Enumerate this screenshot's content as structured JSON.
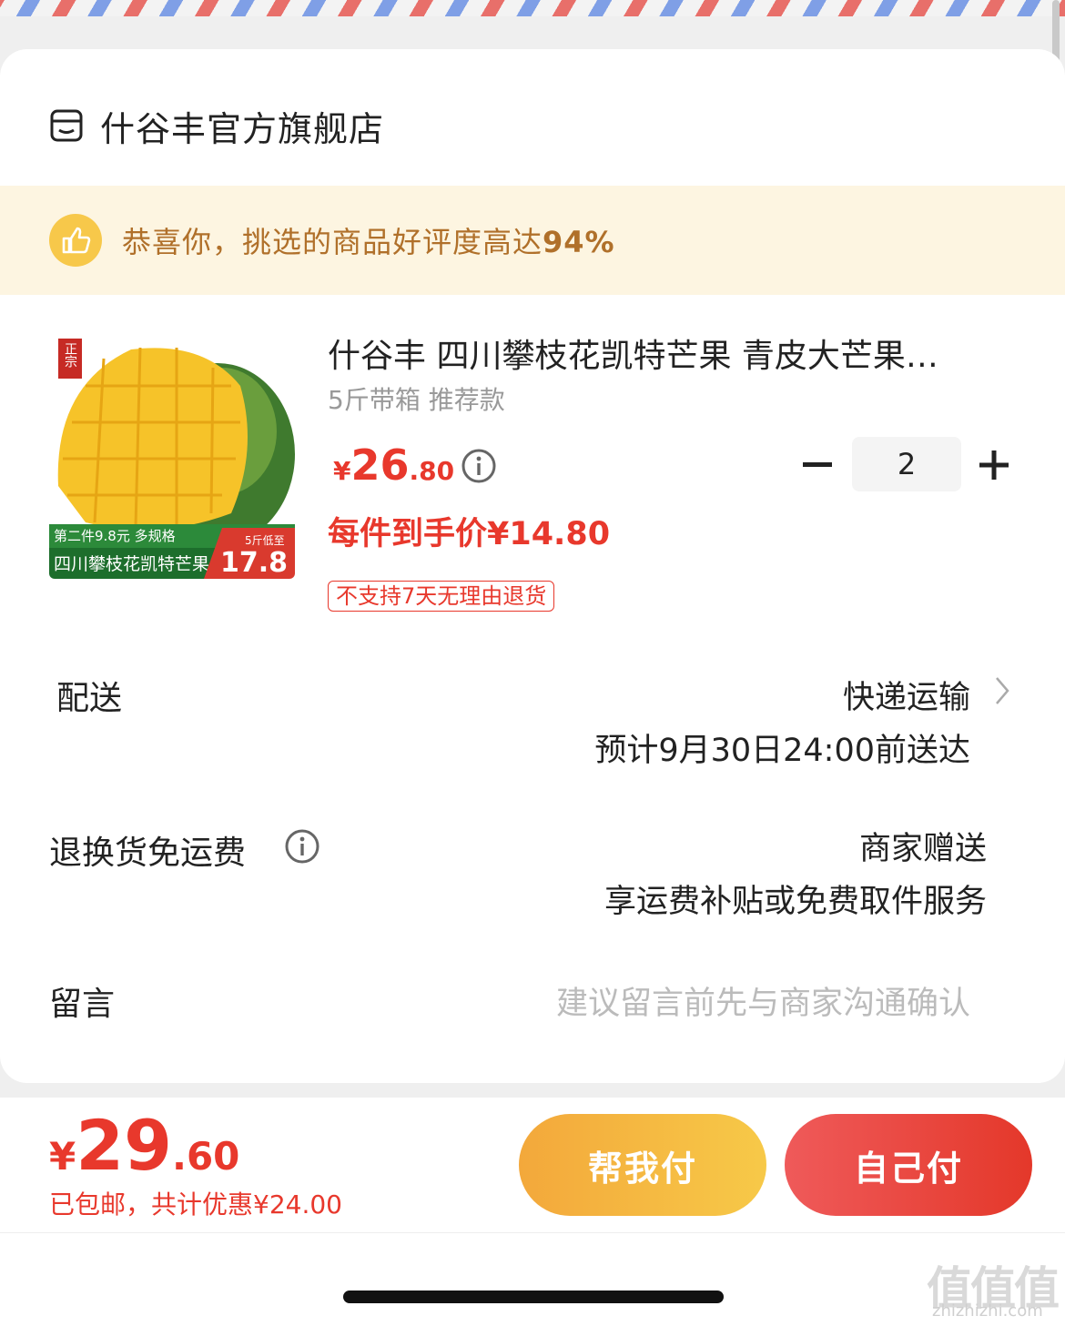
{
  "store": {
    "name": "什谷丰官方旗舰店",
    "icon": "store-icon"
  },
  "banner": {
    "text": "恭喜你，挑选的商品好评度高达",
    "rate": "94%",
    "icon": "thumbs-up-icon"
  },
  "product": {
    "title": "什谷丰 四川攀枝花凯特芒果 青皮大芒果…",
    "spec": "5斤带箱 推荐款",
    "price_currency": "¥",
    "price_int": "26",
    "price_dec": ".80",
    "unit_price": "每件到手价¥14.80",
    "tag": "不支持7天无理由退货",
    "quantity": "2",
    "image": {
      "badge": "正宗",
      "promo_line": "第二件9.8元 多规格",
      "name_line": "四川攀枝花凯特芒果",
      "low_label": "5斤低至",
      "low_price": "17.8"
    }
  },
  "delivery": {
    "label": "配送",
    "method": "快递运输",
    "eta": "预计9月30日24:00前送达"
  },
  "return_shipping": {
    "label": "退换货免运费",
    "value": "商家赠送",
    "detail": "享运费补贴或免费取件服务"
  },
  "note": {
    "label": "留言",
    "placeholder": "建议留言前先与商家沟通确认"
  },
  "checkout": {
    "currency": "¥",
    "total_int": "29",
    "total_dec": ".60",
    "shipping_text": "已包邮，共计优惠¥24.00",
    "help_pay": "帮我付",
    "self_pay": "自己付"
  },
  "watermark": {
    "logo": "值值值",
    "site": "zhizhizhi.com"
  },
  "colors": {
    "accent_red": "#e8382c",
    "banner_bg": "#fdf5e1",
    "banner_text": "#b0702a",
    "help_btn": "#f3a83b"
  }
}
